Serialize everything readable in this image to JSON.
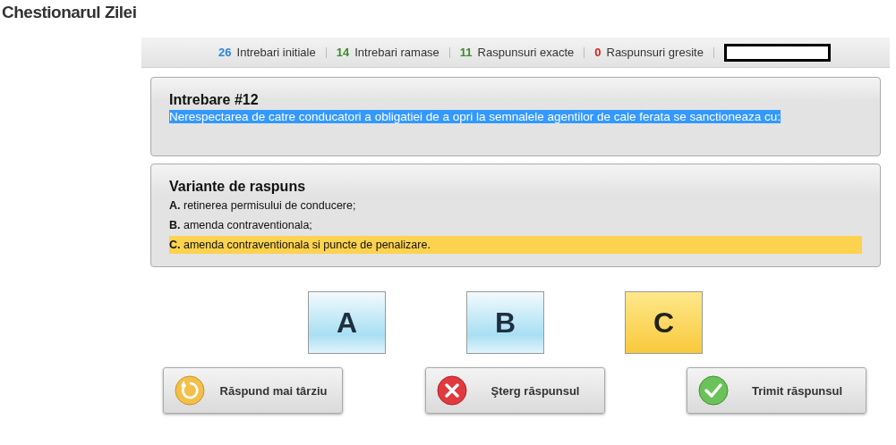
{
  "page_title": "Chestionarul Zilei",
  "stats": [
    {
      "count": "26",
      "label": "Intrebari initiale",
      "color": "#2f86d6"
    },
    {
      "count": "14",
      "label": "Intrebari ramase",
      "color": "#3f8a2e"
    },
    {
      "count": "11",
      "label": "Raspunsuri exacte",
      "color": "#3f8a2e"
    },
    {
      "count": "0",
      "label": "Raspunsuri gresite",
      "color": "#d8201c"
    }
  ],
  "question": {
    "title": "Intrebare #12",
    "text": "Nerespectarea de catre conducatori a obligatiei de a opri la semnalele agentilor de cale ferata se sanctioneaza cu:",
    "highlighted": true
  },
  "answers_title": "Variante de raspuns",
  "answers": [
    {
      "letter": "A.",
      "text": "retinerea permisului de conducere;",
      "selected": false
    },
    {
      "letter": "B.",
      "text": "amenda contraventionala;",
      "selected": false
    },
    {
      "letter": "C.",
      "text": "amenda contraventionala si puncte de penalizare.",
      "selected": true
    }
  ],
  "letter_buttons": [
    {
      "label": "A",
      "selected": false
    },
    {
      "label": "B",
      "selected": false
    },
    {
      "label": "C",
      "selected": true
    }
  ],
  "actions": [
    {
      "label": "Răspund mai târziu",
      "kind": "later"
    },
    {
      "label": "Şterg răspunsul",
      "kind": "clear"
    },
    {
      "label": "Trimit răspunsul",
      "kind": "submit"
    }
  ]
}
